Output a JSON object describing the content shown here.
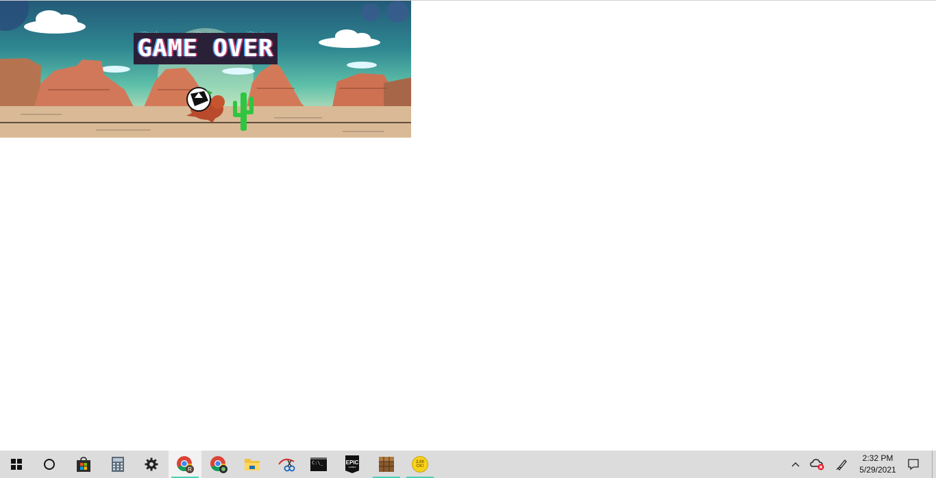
{
  "game": {
    "title_banner": "GAME OVER",
    "watermark": "iStock"
  },
  "taskbar": {
    "apps": [
      {
        "name": "Start",
        "icon": "windows-logo-icon"
      },
      {
        "name": "Cortana",
        "icon": "cortana-circle-icon"
      },
      {
        "name": "Microsoft Store",
        "icon": "store-bag-icon"
      },
      {
        "name": "Calculator",
        "icon": "calculator-icon"
      },
      {
        "name": "Settings",
        "icon": "gear-icon"
      },
      {
        "name": "Google Chrome",
        "icon": "chrome-icon",
        "badge": "R",
        "active": true
      },
      {
        "name": "Google Chrome (profile)",
        "icon": "chrome-icon"
      },
      {
        "name": "File Explorer",
        "icon": "folder-icon"
      },
      {
        "name": "Snipping Tool",
        "icon": "scissors-icon"
      },
      {
        "name": "Command Prompt",
        "icon": "terminal-icon",
        "label": "C:\\_"
      },
      {
        "name": "Epic Games Launcher",
        "icon": "epic-games-icon",
        "label": "EPIC",
        "sublabel": "GAMES"
      },
      {
        "name": "Minecraft",
        "icon": "crafting-table-icon",
        "running": true
      },
      {
        "name": "Coin app",
        "icon": "coin-icon",
        "label": "2.00",
        "sublabel": "CK!",
        "running": true
      }
    ],
    "tray": {
      "chevron_icon": "chevron-up-icon",
      "onedrive_icon": "onedrive-error-icon",
      "pen_icon": "pen-icon",
      "notification_icon": "action-center-icon"
    },
    "clock": {
      "time": "2:32 PM",
      "date": "5/29/2021"
    }
  }
}
